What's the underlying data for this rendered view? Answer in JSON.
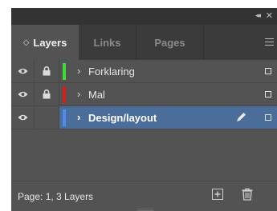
{
  "panel": {
    "tabs": [
      {
        "label": "Layers",
        "active": true,
        "icon": "sort-icon"
      },
      {
        "label": "Links",
        "active": false
      },
      {
        "label": "Pages",
        "active": false
      }
    ],
    "collapse_glyph": "◂◂",
    "close_glyph": "✕"
  },
  "layers": [
    {
      "name": "Forklaring",
      "visible": true,
      "locked": true,
      "color": "#3fdc3f",
      "selected": false
    },
    {
      "name": "Mal",
      "visible": true,
      "locked": true,
      "color": "#d51f1f",
      "selected": false
    },
    {
      "name": "Design/layout",
      "visible": true,
      "locked": false,
      "color": "#4e8cf0",
      "selected": true
    }
  ],
  "footer": {
    "status": "Page: 1, 3 Layers"
  },
  "icons": {
    "eye": "eye-icon",
    "lock": "lock-icon",
    "pen": "pen-icon",
    "new_layer": "new-layer-icon",
    "trash": "trash-icon",
    "panel_menu": "panel-menu-icon"
  },
  "glyphs": {
    "chevron": "›",
    "sort": "◇"
  }
}
